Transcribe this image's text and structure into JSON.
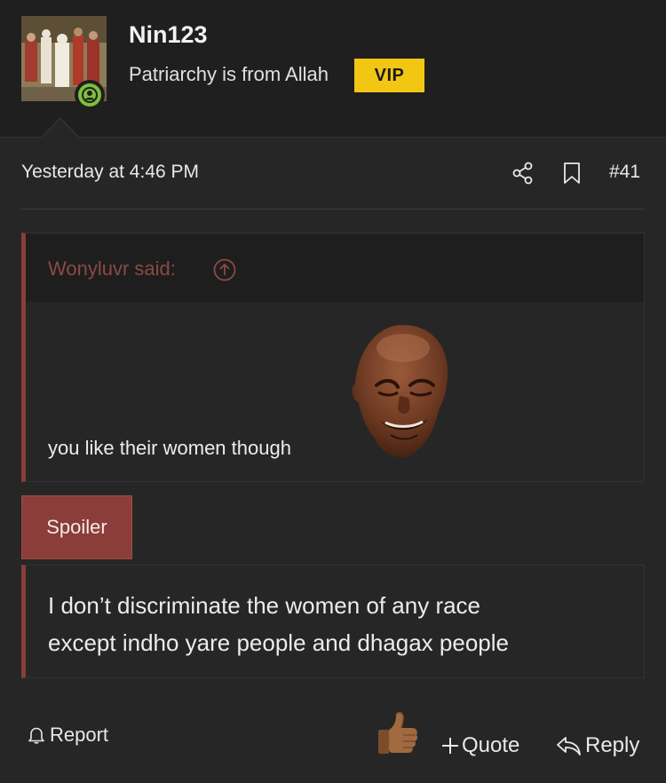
{
  "user": {
    "name": "Nin123",
    "title": "Patriarchy is from Allah",
    "badge": "VIP",
    "online": true
  },
  "post": {
    "date": "Yesterday at 4:46 PM",
    "number": "#41"
  },
  "quote": {
    "author": "Wonyluvr said:",
    "text": "you like their women though"
  },
  "spoiler": {
    "button_label": "Spoiler",
    "line1": "I don’t discriminate the women of any race",
    "line2": "except indho yare people and dhagax people"
  },
  "actions": {
    "report": "Report",
    "quote": "Quote",
    "reply": "Reply"
  },
  "colors": {
    "accent": "#8a3d39",
    "vip": "#f3c614",
    "online": "#7fbf3a"
  }
}
